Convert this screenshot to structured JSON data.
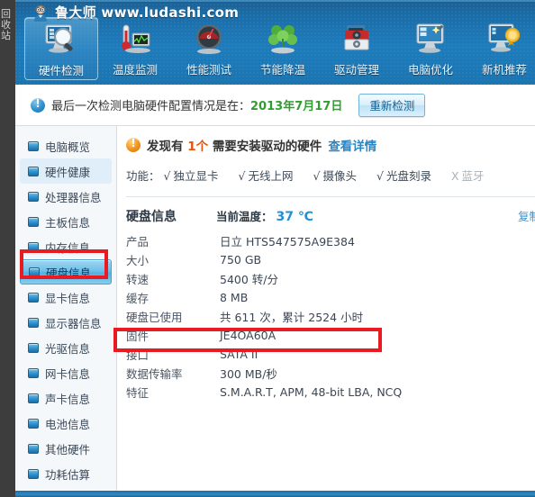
{
  "window": {
    "desktop_strip_text": "回收站",
    "brand_title": "鲁大师 www.ludashi.com",
    "avatar_icon": "mascot-avatar-icon"
  },
  "toolbar": {
    "items": [
      {
        "label": "硬件检测",
        "icon": "monitor-magnifier-icon",
        "active": true
      },
      {
        "label": "温度监测",
        "icon": "thermometer-chart-icon",
        "active": false
      },
      {
        "label": "性能测试",
        "icon": "speedometer-icon",
        "active": false
      },
      {
        "label": "节能降温",
        "icon": "green-clover-icon",
        "active": false
      },
      {
        "label": "驱动管理",
        "icon": "toolbox-gear-icon",
        "active": false
      },
      {
        "label": "电脑优化",
        "icon": "monitor-wand-icon",
        "active": false
      },
      {
        "label": "新机推荐",
        "icon": "monitor-badge-icon",
        "active": false
      }
    ]
  },
  "infobar": {
    "icon": "info-exclamation-icon",
    "text_prefix": "最后一次检测电脑硬件配置情况是在：",
    "date": "2013年7月17日",
    "rescan_label": "重新检测"
  },
  "sidebar": {
    "items": [
      {
        "label": "电脑概览",
        "state": "normal"
      },
      {
        "label": "硬件健康",
        "state": "hover"
      },
      {
        "label": "处理器信息",
        "state": "normal"
      },
      {
        "label": "主板信息",
        "state": "normal"
      },
      {
        "label": "内存信息",
        "state": "normal"
      },
      {
        "label": "硬盘信息",
        "state": "selected"
      },
      {
        "label": "显卡信息",
        "state": "normal"
      },
      {
        "label": "显示器信息",
        "state": "normal"
      },
      {
        "label": "光驱信息",
        "state": "normal"
      },
      {
        "label": "网卡信息",
        "state": "normal"
      },
      {
        "label": "声卡信息",
        "state": "normal"
      },
      {
        "label": "电池信息",
        "state": "normal"
      },
      {
        "label": "其他硬件",
        "state": "normal"
      },
      {
        "label": "功耗估算",
        "state": "normal"
      }
    ]
  },
  "driver_notice": {
    "icon": "warning-exclamation-icon",
    "prefix": "发现有",
    "count": "1个",
    "suffix": "需要安装驱动的硬件",
    "link_label": "查看详情"
  },
  "features": {
    "lead": "功能：",
    "items": [
      {
        "mark": "√",
        "label": "独立显卡",
        "enabled": true
      },
      {
        "mark": "√",
        "label": "无线上网",
        "enabled": true
      },
      {
        "mark": "√",
        "label": "摄像头",
        "enabled": true
      },
      {
        "mark": "√",
        "label": "光盘刻录",
        "enabled": true
      },
      {
        "mark": "X",
        "label": "蓝牙",
        "enabled": false
      }
    ]
  },
  "disk": {
    "section_title": "硬盘信息",
    "temp_label": "当前温度：",
    "temp_value": "37 ℃",
    "copy_label": "复制",
    "rows": [
      {
        "key": "产品",
        "value": "日立  HTS547575A9E384"
      },
      {
        "key": "大小",
        "value": "750 GB"
      },
      {
        "key": "转速",
        "value": "5400 转/分"
      },
      {
        "key": "缓存",
        "value": "8 MB"
      },
      {
        "key": "硬盘已使用",
        "value": "共 611 次，累计 2524 小时"
      },
      {
        "key": "固件",
        "value": "JE4OA60A"
      },
      {
        "key": "接口",
        "value": "SATA II"
      },
      {
        "key": "数据传输率",
        "value": "300 MB/秒"
      },
      {
        "key": "特征",
        "value": "S.M.A.R.T,  APM,  48-bit LBA,  NCQ"
      }
    ]
  },
  "annotations": [
    {
      "name": "sidebar-disk-highlight",
      "color": "#e81b23"
    },
    {
      "name": "disk-usage-highlight",
      "color": "#e81b23"
    }
  ],
  "colors": {
    "brand_blue": "#1e7cbc",
    "accent_link": "#2b86c6",
    "warn_orange": "#e8520d",
    "date_green": "#2f9e2f",
    "temp_blue": "#1f8fd6",
    "annotation_red": "#e81b23"
  }
}
